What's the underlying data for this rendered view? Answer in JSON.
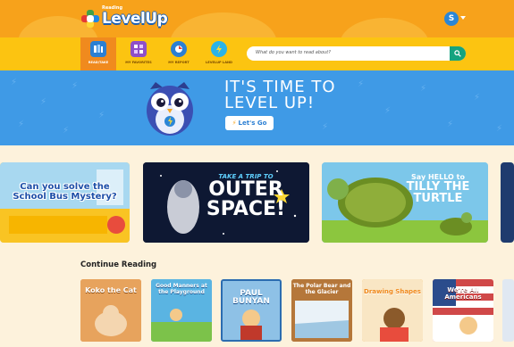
{
  "header": {
    "logo_small": "Reading",
    "logo_text": "LevelUp",
    "avatar_initial": "S"
  },
  "nav": {
    "items": [
      {
        "label": "READ/TAKE",
        "icon": "books-icon"
      },
      {
        "label": "MY FAVORITES",
        "icon": "favorites-icon"
      },
      {
        "label": "MY REPORT",
        "icon": "report-icon"
      },
      {
        "label": "LEVELUP LAND",
        "icon": "lightning-icon"
      }
    ]
  },
  "search": {
    "placeholder": "What do you want to read about?"
  },
  "hero": {
    "title_line1": "IT'S TIME TO",
    "title_line2": "LEVEL UP!",
    "button_label": "Let's Go"
  },
  "carousel": {
    "cards": [
      {
        "title_line1": "Can you solve the",
        "title_line2": "School Bus Mystery?"
      },
      {
        "title_top": "TAKE A TRIP TO",
        "title_line1": "OUTER",
        "title_line2": "SPACE!"
      },
      {
        "title_top": "Say HELLO to",
        "title_line1": "TILLY THE",
        "title_line2": "TURTLE"
      }
    ]
  },
  "continue_reading": {
    "title": "Continue Reading",
    "books": [
      {
        "title": "Koko the Cat",
        "color": "#e7a35d"
      },
      {
        "title": "Good Manners at the Playground",
        "color": "#5ab4e2"
      },
      {
        "title": "PAUL BUNYAN",
        "color": "#6ba9d8"
      },
      {
        "title": "The Polar Bear and the Glacier",
        "color": "#b5773a"
      },
      {
        "title": "Drawing Shapes",
        "color": "#f5a623"
      },
      {
        "title": "We're All Americans",
        "color": "#d04848"
      }
    ]
  },
  "colors": {
    "header_orange": "#f7a21b",
    "nav_yellow": "#fcc411",
    "hero_blue": "#3f9ae6",
    "search_green": "#14a37f"
  }
}
